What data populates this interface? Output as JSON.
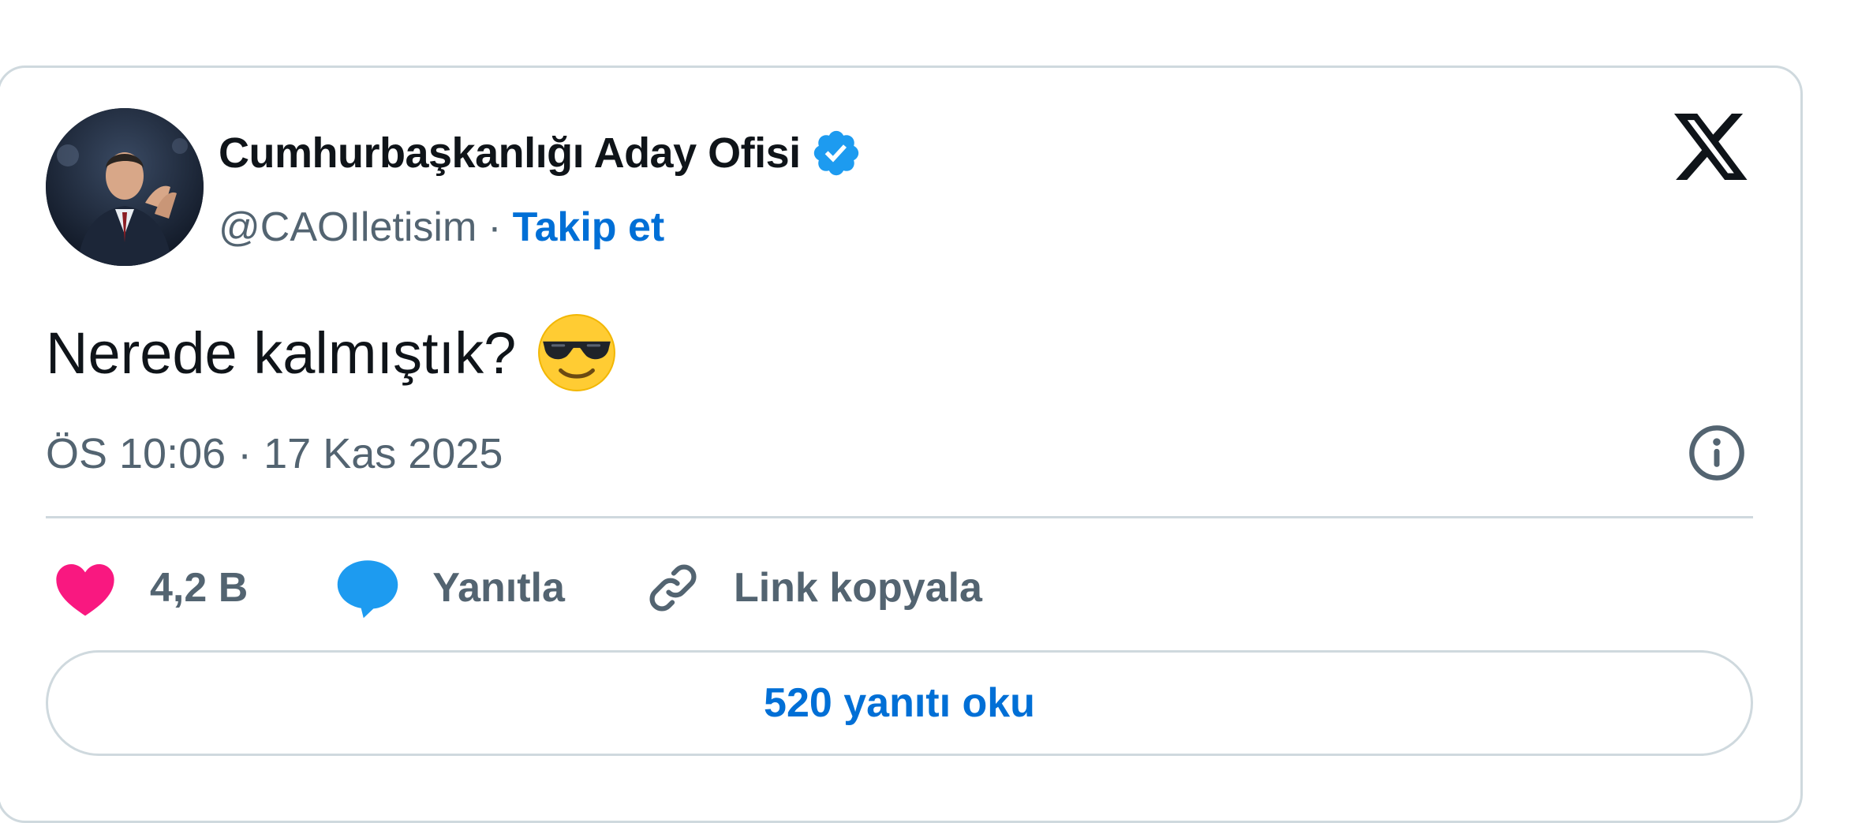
{
  "tweet": {
    "author": {
      "display_name": "Cumhurbaşkanlığı Aday Ofisi",
      "handle": "@CAOIletisim",
      "separator": "·",
      "follow_label": "Takip et",
      "verified_icon": "verified-badge-icon",
      "avatar": "profile-photo-avatar"
    },
    "platform_icon": "x-logo-icon",
    "text": "Nerede kalmıştık?",
    "emoji": "smiling-face-with-sunglasses-icon",
    "timestamp": "ÖS 10:06 · 17 Kas 2025",
    "info_icon": "info-circle-icon",
    "actions": {
      "like_count": "4,2 B",
      "reply_label": "Yanıtla",
      "copy_link_label": "Link kopyala"
    },
    "read_replies_label": "520 yanıtı oku"
  },
  "colors": {
    "text_primary": "#0f1419",
    "text_secondary": "#536471",
    "link_blue": "#006fd6",
    "verified_blue": "#1d9bf0",
    "like_pink": "#f91880",
    "reply_blue": "#1d9bf0",
    "border": "#cfd9de",
    "emoji_yellow": "#ffcc33"
  }
}
